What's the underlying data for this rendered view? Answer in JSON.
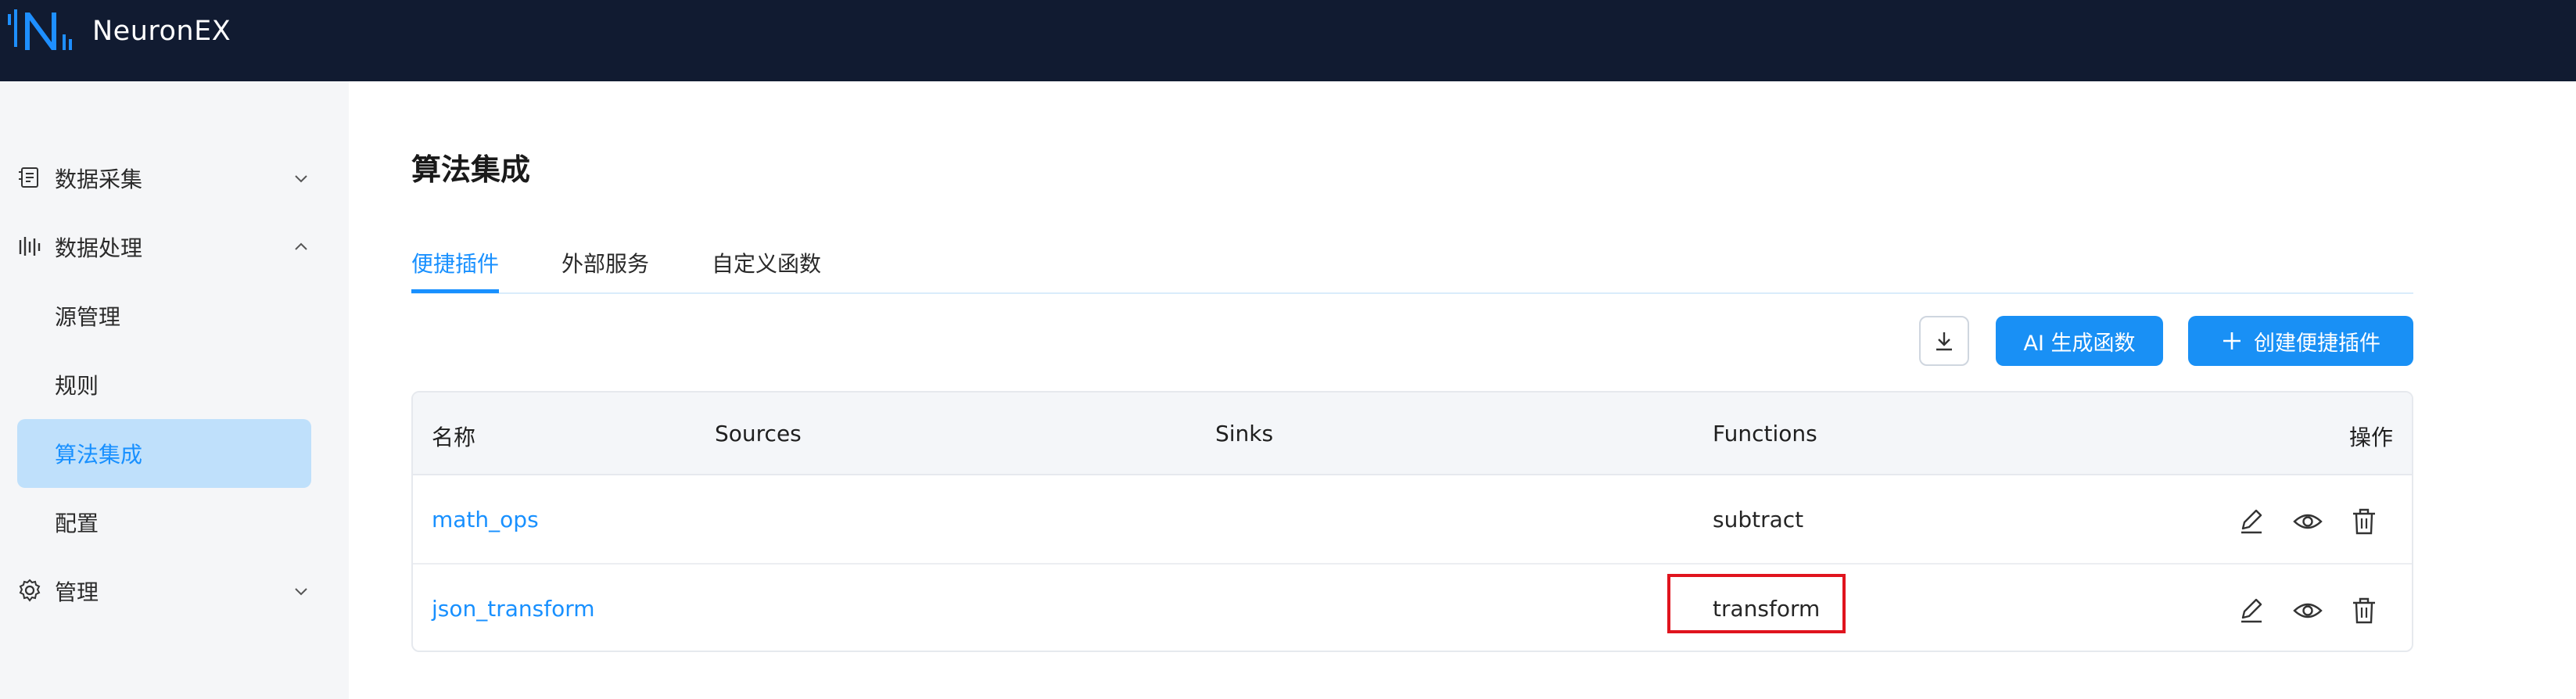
{
  "app": {
    "brand": "NeuronEX"
  },
  "sidebar": {
    "groups": [
      {
        "label": "数据采集",
        "icon": "data-collection-icon",
        "expanded": false
      },
      {
        "label": "数据处理",
        "icon": "data-processing-icon",
        "expanded": true
      },
      {
        "label": "管理",
        "icon": "gear-icon",
        "expanded": false
      }
    ],
    "sub_items": [
      {
        "label": "源管理",
        "active": false
      },
      {
        "label": "规则",
        "active": false
      },
      {
        "label": "算法集成",
        "active": true
      },
      {
        "label": "配置",
        "active": false
      }
    ]
  },
  "main": {
    "title": "算法集成",
    "tabs": [
      {
        "label": "便捷插件",
        "active": true
      },
      {
        "label": "外部服务",
        "active": false
      },
      {
        "label": "自定义函数",
        "active": false
      }
    ],
    "toolbar": {
      "ai_button": "AI 生成函数",
      "create_button": "创建便捷插件"
    },
    "table": {
      "columns": [
        "名称",
        "Sources",
        "Sinks",
        "Functions",
        "操作"
      ],
      "rows": [
        {
          "name": "math_ops",
          "sources": "",
          "sinks": "",
          "functions": "subtract"
        },
        {
          "name": "json_transform",
          "sources": "",
          "sinks": "",
          "functions": "transform"
        }
      ]
    }
  },
  "colors": {
    "topbar": "#111b31",
    "accent": "#1890ff",
    "highlight": "#e0141e",
    "active_menu_bg": "#bfe0fb"
  }
}
